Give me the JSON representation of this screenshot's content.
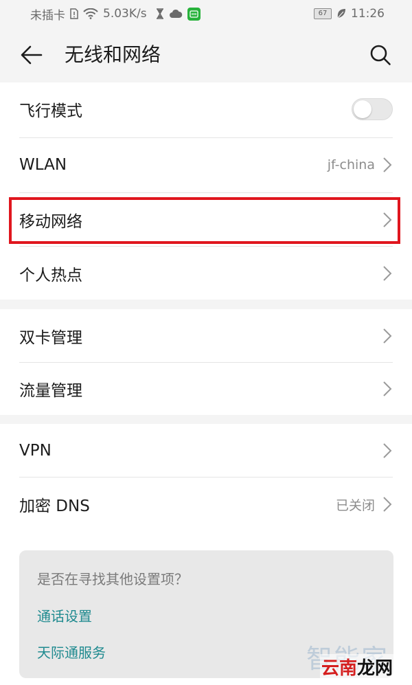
{
  "status_bar": {
    "carrier": "未插卡",
    "speed": "5.03K/s",
    "battery": "67",
    "time": "11:26",
    "icons": [
      "sim-icon",
      "wifi-icon",
      "hourglass-icon",
      "cloud-icon",
      "app-notification-icon",
      "leaf-icon"
    ]
  },
  "header": {
    "title": "无线和网络",
    "back_icon": "back-arrow-icon",
    "search_icon": "search-icon"
  },
  "sections": {
    "network": {
      "airplane_mode": {
        "label": "飞行模式",
        "enabled": false
      },
      "wlan": {
        "label": "WLAN",
        "value": "jf-china"
      },
      "mobile_network": {
        "label": "移动网络"
      },
      "hotspot": {
        "label": "个人热点"
      }
    },
    "management": {
      "dual_sim": {
        "label": "双卡管理"
      },
      "data_usage": {
        "label": "流量管理"
      }
    },
    "privacy": {
      "vpn": {
        "label": "VPN"
      },
      "private_dns": {
        "label": "加密 DNS",
        "value": "已关闭"
      }
    }
  },
  "suggestions": {
    "title": "是否在寻找其他设置项？",
    "links": [
      "通话设置",
      "天际通服务"
    ]
  },
  "watermark": {
    "text1": "智能家",
    "text2_a": "云南",
    "text2_b": "龙网"
  },
  "colors": {
    "highlight": "#e0161e",
    "link": "#1f8a8f",
    "background": "#f4f4f4"
  }
}
